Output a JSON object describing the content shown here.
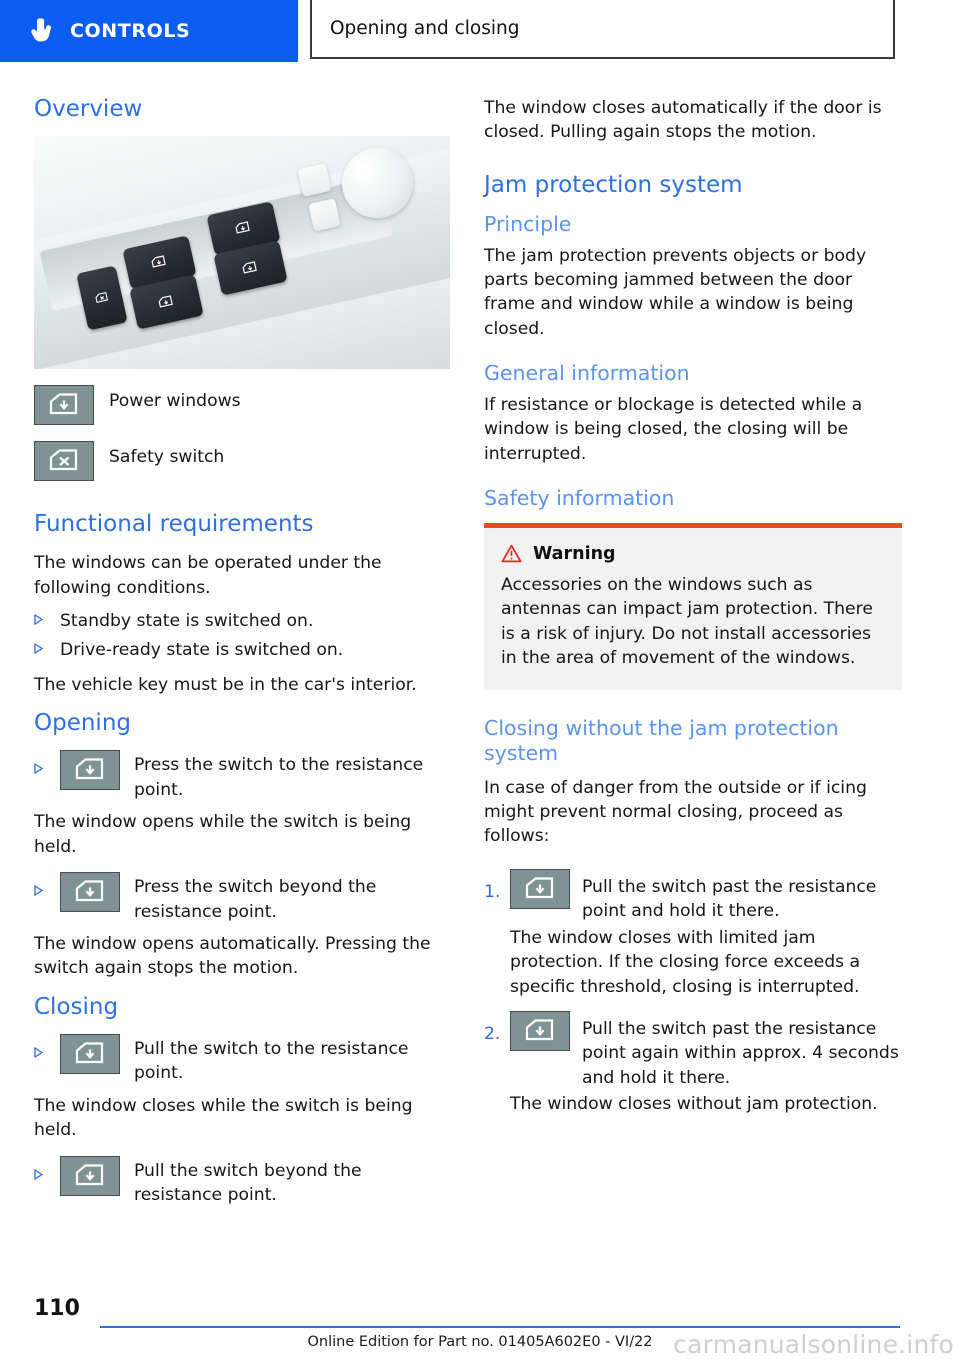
{
  "header": {
    "tab_label": "CONTROLS",
    "breadcrumb": "Opening and closing",
    "hand_icon": "hand-pointer-icon",
    "tab_color": "#0b5cf0"
  },
  "left_column": {
    "overview_heading": "Overview",
    "photo_caption_alt": "door-panel-power-window-switches-photo",
    "legend": [
      {
        "icon": "power-window-switch-icon",
        "label": "Power windows"
      },
      {
        "icon": "safety-switch-icon",
        "label": "Safety switch"
      }
    ],
    "functional_requirements": {
      "heading": "Functional requirements",
      "intro": "The windows can be operated under the following conditions.",
      "bullets": [
        "Standby state is switched on.",
        "Drive-ready state is switched on."
      ],
      "note": "The vehicle key must be in the car's interior."
    },
    "opening": {
      "heading": "Opening",
      "steps": [
        {
          "icon": "power-window-switch-icon",
          "action": "Press the switch to the resistance point.",
          "result": "The window opens while the switch is being held."
        },
        {
          "icon": "power-window-switch-icon",
          "action": "Press the switch beyond the resistance point.",
          "result": "The window opens automatically. Pressing the switch again stops the motion."
        }
      ]
    },
    "closing": {
      "heading": "Closing",
      "steps": [
        {
          "icon": "power-window-switch-icon",
          "action": "Pull the switch to the resistance point.",
          "result": "The window closes while the switch is being held."
        },
        {
          "icon": "power-window-switch-icon",
          "action": "Pull the switch beyond the resistance point.",
          "result": ""
        }
      ]
    }
  },
  "right_column": {
    "continued_text": "The window closes automatically if the door is closed. Pulling again stops the motion.",
    "jam_protection": {
      "heading": "Jam protection system",
      "principle_heading": "Principle",
      "principle_text": "The jam protection prevents objects or body parts becoming jammed between the door frame and window while a window is being closed.",
      "general_heading": "General information",
      "general_text": "If resistance or blockage is detected while a window is being closed, the closing will be interrupted.",
      "safety_heading": "Safety information"
    },
    "warning": {
      "icon": "warning-triangle-icon",
      "title": "Warning",
      "text": "Accessories on the windows such as antennas can impact jam protection. There is a risk of injury. Do not install accessories in the area of movement of the windows.",
      "accent_color": "#f1471d",
      "background_color": "#f2f2f2"
    },
    "closing_without_jam": {
      "heading": "Closing without the jam protection system",
      "intro": "In case of danger from the outside or if icing might prevent normal closing, proceed as follows:",
      "steps": [
        {
          "number": "1.",
          "icon": "power-window-switch-icon",
          "action": "Pull the switch past the resistance point and hold it there.",
          "result": "The window closes with limited jam protection. If the closing force exceeds a specific threshold, closing is interrupted."
        },
        {
          "number": "2.",
          "icon": "power-window-switch-icon",
          "action": "Pull the switch past the resistance point again within approx. 4 seconds and hold it there.",
          "result": "The window closes without jam protection."
        }
      ]
    }
  },
  "footer": {
    "page_number": "110",
    "edition_note": "Online Edition for Part no. 01405A602E0 - VI/22",
    "watermark": "carmanualsonline.info",
    "rule_color": "#2f6fe0"
  },
  "theme": {
    "heading_blue": "#2f6fe0",
    "subheading_blue": "#5b93ee",
    "chip_gray": "#7f9395",
    "text_black": "#161616"
  }
}
